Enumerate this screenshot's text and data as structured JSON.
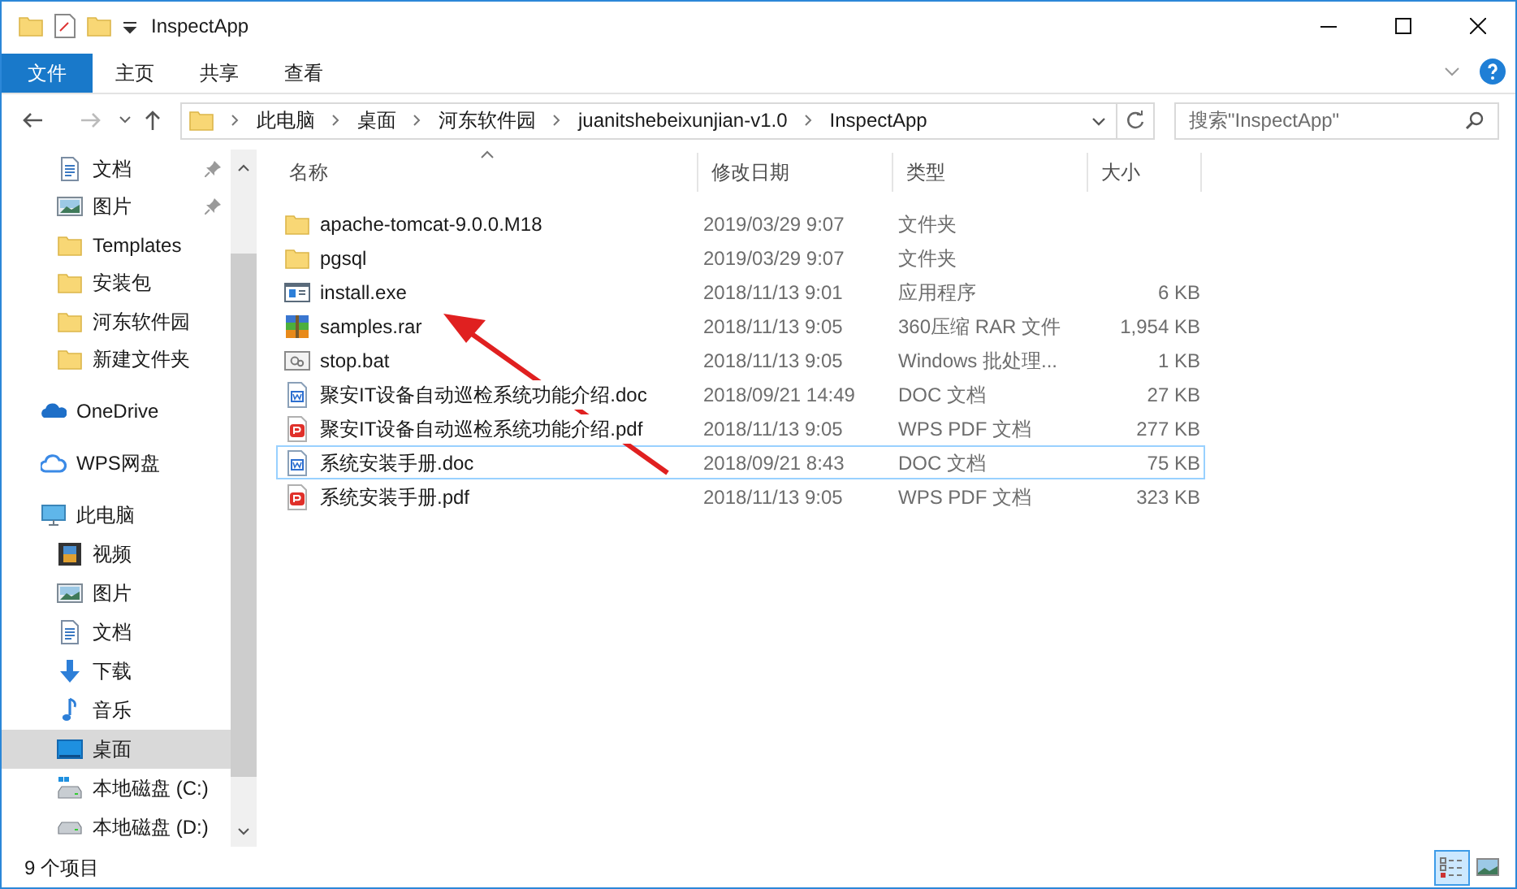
{
  "window": {
    "title": "InspectApp"
  },
  "ribbon_tabs": [
    {
      "label": "文件",
      "kind": "file"
    },
    {
      "label": "主页",
      "kind": "tab"
    },
    {
      "label": "共享",
      "kind": "tab"
    },
    {
      "label": "查看",
      "kind": "tab"
    }
  ],
  "address_bar": {
    "path": [
      "此电脑",
      "桌面",
      "河东软件园",
      "juanitshebeixunjian-v1.0",
      "InspectApp"
    ]
  },
  "search": {
    "placeholder": "搜索\"InspectApp\""
  },
  "sidebar": {
    "quick_access": [
      {
        "label": "文档",
        "kind": "docs",
        "pinned": true,
        "selected": false
      },
      {
        "label": "图片",
        "kind": "pictures",
        "pinned": true,
        "selected": false
      },
      {
        "label": "Templates",
        "kind": "folder",
        "pinned": false,
        "selected": false
      },
      {
        "label": "安装包",
        "kind": "folder",
        "pinned": false,
        "selected": false
      },
      {
        "label": "河东软件园",
        "kind": "folder",
        "pinned": false,
        "selected": false
      },
      {
        "label": "新建文件夹",
        "kind": "folder",
        "pinned": false,
        "selected": false
      }
    ],
    "items": [
      {
        "label": "OneDrive",
        "kind": "onedrive",
        "selected": false
      },
      {
        "label": "WPS网盘",
        "kind": "cloud",
        "selected": false
      },
      {
        "label": "此电脑",
        "kind": "pc",
        "selected": false,
        "children": [
          {
            "label": "视频",
            "kind": "video",
            "selected": false
          },
          {
            "label": "图片",
            "kind": "pictures",
            "selected": false
          },
          {
            "label": "文档",
            "kind": "docs",
            "selected": false
          },
          {
            "label": "下载",
            "kind": "download",
            "selected": false
          },
          {
            "label": "音乐",
            "kind": "music",
            "selected": false
          },
          {
            "label": "桌面",
            "kind": "desktop",
            "selected": true
          },
          {
            "label": "本地磁盘 (C:)",
            "kind": "drive-system",
            "selected": false
          },
          {
            "label": "本地磁盘 (D:)",
            "kind": "drive",
            "selected": false
          }
        ]
      }
    ]
  },
  "table": {
    "columns": [
      {
        "label": "名称",
        "sorted": true
      },
      {
        "label": "修改日期",
        "sorted": false
      },
      {
        "label": "类型",
        "sorted": false
      },
      {
        "label": "大小",
        "sorted": false
      }
    ],
    "rows": [
      {
        "kind": "folder",
        "name": "apache-tomcat-9.0.0.M18",
        "date": "2019/03/29 9:07",
        "type": "文件夹",
        "focused": false
      },
      {
        "kind": "folder",
        "name": "pgsql",
        "date": "2019/03/29 9:07",
        "type": "文件夹",
        "focused": false
      },
      {
        "kind": "exe",
        "name": "install.exe",
        "date": "2018/11/13 9:01",
        "type": "应用程序",
        "size": "6 KB",
        "focused": false
      },
      {
        "kind": "rar",
        "name": "samples.rar",
        "date": "2018/11/13 9:05",
        "type": "360压缩 RAR 文件",
        "size": "1,954 KB",
        "focused": false
      },
      {
        "kind": "bat",
        "name": "stop.bat",
        "date": "2018/11/13 9:05",
        "type": "Windows 批处理...",
        "size": "1 KB",
        "focused": false
      },
      {
        "kind": "doc",
        "name": "聚安IT设备自动巡检系统功能介绍.doc",
        "date": "2018/09/21 14:49",
        "type": "DOC 文档",
        "size": "27 KB",
        "focused": false
      },
      {
        "kind": "pdf",
        "name": "聚安IT设备自动巡检系统功能介绍.pdf",
        "date": "2018/11/13 9:05",
        "type": "WPS PDF 文档",
        "size": "277 KB",
        "focused": false
      },
      {
        "kind": "doc",
        "name": "系统安装手册.doc",
        "date": "2018/09/21 8:43",
        "type": "DOC 文档",
        "size": "75 KB",
        "focused": true
      },
      {
        "kind": "pdf",
        "name": "系统安装手册.pdf",
        "date": "2018/11/13 9:05",
        "type": "WPS PDF 文档",
        "size": "323 KB",
        "focused": false
      }
    ]
  },
  "status_bar": {
    "count": "9 个项目"
  },
  "view_buttons": [
    {
      "kind": "details",
      "selected": true
    },
    {
      "kind": "large-icons",
      "selected": false
    }
  ]
}
